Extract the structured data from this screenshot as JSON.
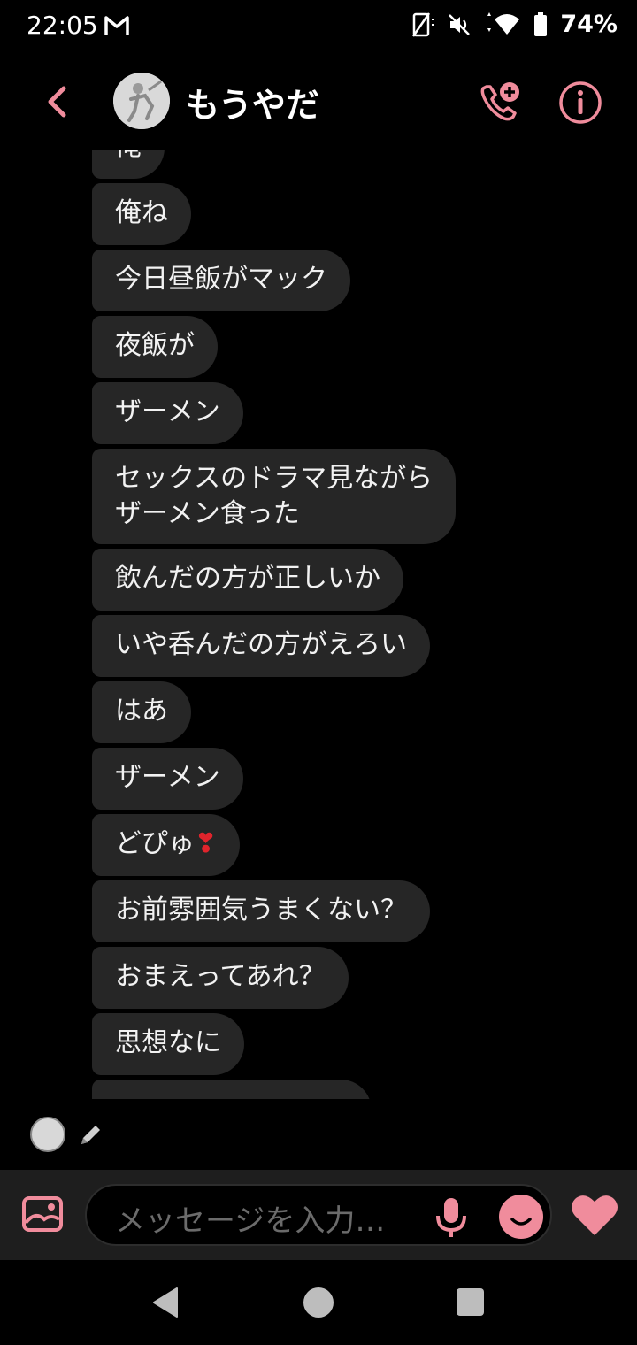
{
  "status": {
    "time": "22:05",
    "battery": "74%",
    "icons": [
      "gmail-icon",
      "no-rotate-icon",
      "mute-icon",
      "wifi-icon",
      "battery-icon"
    ]
  },
  "header": {
    "contact_name": "もうやだ",
    "icons": [
      "back-icon",
      "add-call-icon",
      "info-icon"
    ]
  },
  "messages": [
    "俺",
    "俺ね",
    "今日昼飯がマック",
    "夜飯が",
    "ザーメン",
    "セックスのドラマ見ながら\nザーメン食った",
    "飲んだの方が正しいか",
    "いや呑んだの方がえろい",
    "はあ",
    "ザーメン",
    "どぴゅ",
    "お前雰囲気うまくない？",
    "おまえってあれ？",
    "思想なに",
    ""
  ],
  "heart_emoji": "❣",
  "composer": {
    "placeholder": "メッセージを入力…"
  },
  "colors": {
    "accent": "#f08c9c",
    "bubble": "#262626",
    "background": "#000000"
  }
}
